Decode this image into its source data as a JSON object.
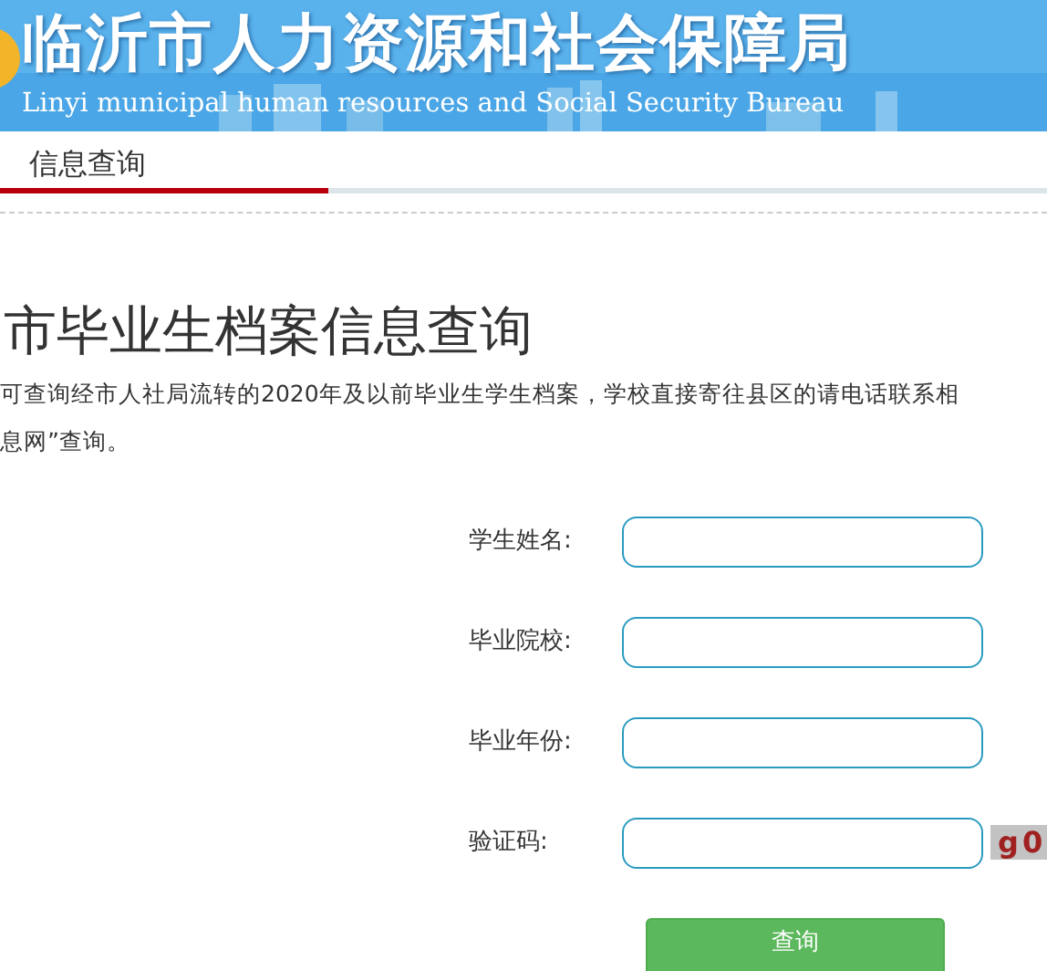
{
  "header": {
    "title": "临沂市人力资源和社会保障局",
    "subtitle": "Linyi municipal human resources and Social Security Bureau"
  },
  "nav": {
    "items": [
      {
        "label": "信息查询",
        "selected": true
      }
    ]
  },
  "page": {
    "heading": "市毕业生档案信息查询",
    "notice_lines": [
      "可查询经市人社局流转的2020年及以前毕业生学生档案，学校直接寄往县区的请电话联系相",
      "息网”查询。"
    ]
  },
  "form": {
    "fields": [
      {
        "kind": "text",
        "label": "学生姓名:"
      },
      {
        "kind": "text",
        "label": "毕业院校:"
      },
      {
        "kind": "text",
        "label": "毕业年份:"
      },
      {
        "kind": "captcha",
        "label": "验证码:",
        "captcha": "g0"
      }
    ],
    "submit": "查询"
  }
}
